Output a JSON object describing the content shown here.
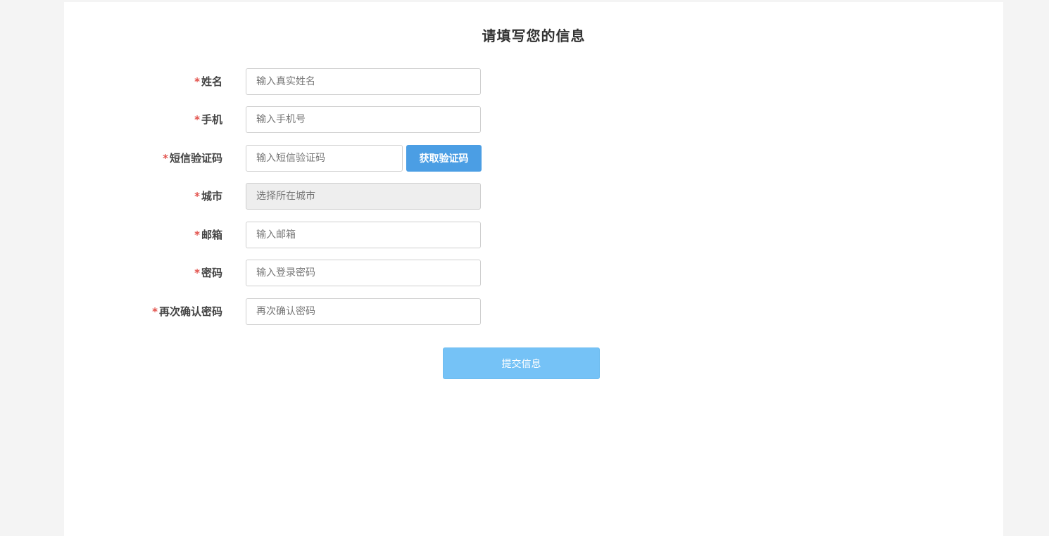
{
  "form": {
    "title": "请填写您的信息",
    "required_mark": "*",
    "fields": [
      {
        "label": "姓名",
        "placeholder": "输入真实姓名"
      },
      {
        "label": "手机",
        "placeholder": "输入手机号"
      },
      {
        "label": "短信验证码",
        "placeholder": "输入短信验证码"
      },
      {
        "label": "城市",
        "placeholder": "选择所在城市"
      },
      {
        "label": "邮箱",
        "placeholder": "输入邮箱"
      },
      {
        "label": "密码",
        "placeholder": "输入登录密码"
      },
      {
        "label": "再次确认密码",
        "placeholder": "再次确认密码"
      }
    ],
    "get_code_label": "获取验证码",
    "submit_label": "提交信息"
  },
  "colors": {
    "required": "#e2504a",
    "primary": "#4b9ee4",
    "submit": "#75c2f6",
    "background": "#f4f4f4"
  }
}
